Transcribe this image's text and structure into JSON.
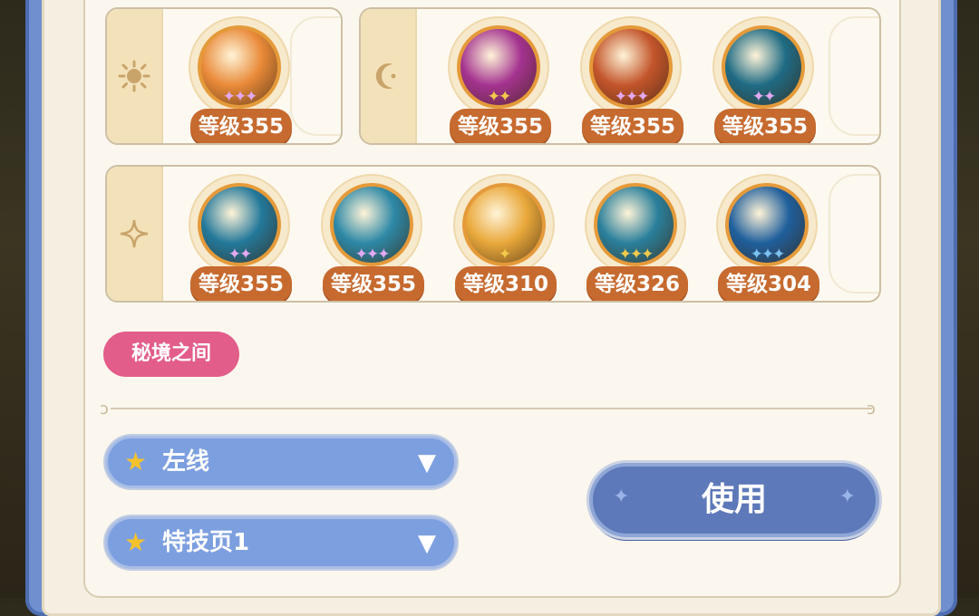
{
  "row1_left": {
    "icon": "sun-icon",
    "slots": [
      {
        "level": "等级355",
        "stars": "✦✦✦",
        "star_color": "#e2a9f0",
        "art": "#e98a39"
      }
    ]
  },
  "row1_right": {
    "icon": "moon-icon",
    "slots": [
      {
        "level": "等级355",
        "stars": "✦✦",
        "star_color": "#f1c94b",
        "art": "#a4338f"
      },
      {
        "level": "等级355",
        "stars": "✦✦✦",
        "star_color": "#e2a9f0",
        "art": "#c3552b"
      },
      {
        "level": "等级355",
        "stars": "✦✦",
        "star_color": "#e2a9f0",
        "art": "#1f6b84"
      }
    ]
  },
  "row2": {
    "icon": "sparkle-icon",
    "slots": [
      {
        "level": "等级355",
        "stars": "✦✦",
        "star_color": "#e2a9f0",
        "art": "#23789a"
      },
      {
        "level": "等级355",
        "stars": "✦✦✦",
        "star_color": "#e2a9f0",
        "art": "#2d88a6"
      },
      {
        "level": "等级310",
        "stars": "✦",
        "star_color": "#f1c94b",
        "art": "#e9a83b"
      },
      {
        "level": "等级326",
        "stars": "✦✦✦",
        "star_color": "#f1c94b",
        "art": "#2a7f9b"
      },
      {
        "level": "等级304",
        "stars": "✦✦✦",
        "star_color": "#7cc1f0",
        "art": "#1f5f9c"
      }
    ]
  },
  "tag": {
    "label": "秘境之间"
  },
  "dropdowns": {
    "lane": {
      "label": "左线"
    },
    "skill_page": {
      "label": "特技页1"
    }
  },
  "use_button": {
    "label": "使用"
  },
  "colors": {
    "accent_blue": "#7c9fe0",
    "button_blue": "#5e79b9",
    "level_badge": "#c76a2f",
    "tag_pink": "#e35d8a"
  }
}
